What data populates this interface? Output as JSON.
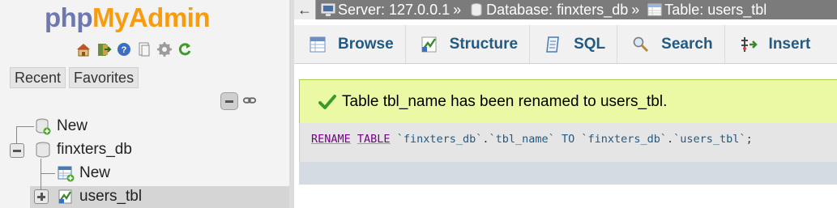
{
  "logo": {
    "php": "php",
    "my": "My",
    "admin": "Admin"
  },
  "nav_icons": [
    "home-icon",
    "logout-icon",
    "help-icon",
    "docs-icon",
    "settings-icon",
    "reload-icon"
  ],
  "nav_tabs": {
    "recent": "Recent",
    "favorites": "Favorites"
  },
  "tree": {
    "new_top": "New",
    "database": "finxters_db",
    "new_table": "New",
    "table": "users_tbl"
  },
  "breadcrumb": {
    "back": "←",
    "server": "Server: 127.0.0.1",
    "database": "Database: finxters_db",
    "table": "Table: users_tbl",
    "separator": "»"
  },
  "tabs": [
    {
      "label": "Browse",
      "icon": "browse-icon"
    },
    {
      "label": "Structure",
      "icon": "structure-icon"
    },
    {
      "label": "SQL",
      "icon": "sql-icon"
    },
    {
      "label": "Search",
      "icon": "search-icon"
    },
    {
      "label": "Insert",
      "icon": "insert-icon"
    }
  ],
  "message": {
    "text": "Table tbl_name has been renamed to users_tbl."
  },
  "sql": {
    "kw1": "RENAME",
    "kw2": "TABLE",
    "db1": "`finxters_db`",
    "dot1": ".",
    "t1": "`tbl_name`",
    "kw3": "TO",
    "db2": "`finxters_db`",
    "dot2": ".",
    "t2": "`users_tbl`",
    "end": ";"
  },
  "colors": {
    "accent": "#235a81",
    "success_bg": "#ebf8a4",
    "breadcrumb_bg": "#7b7b7b",
    "logo_php": "#6c78af",
    "logo_myadmin": "#f89c0e"
  }
}
